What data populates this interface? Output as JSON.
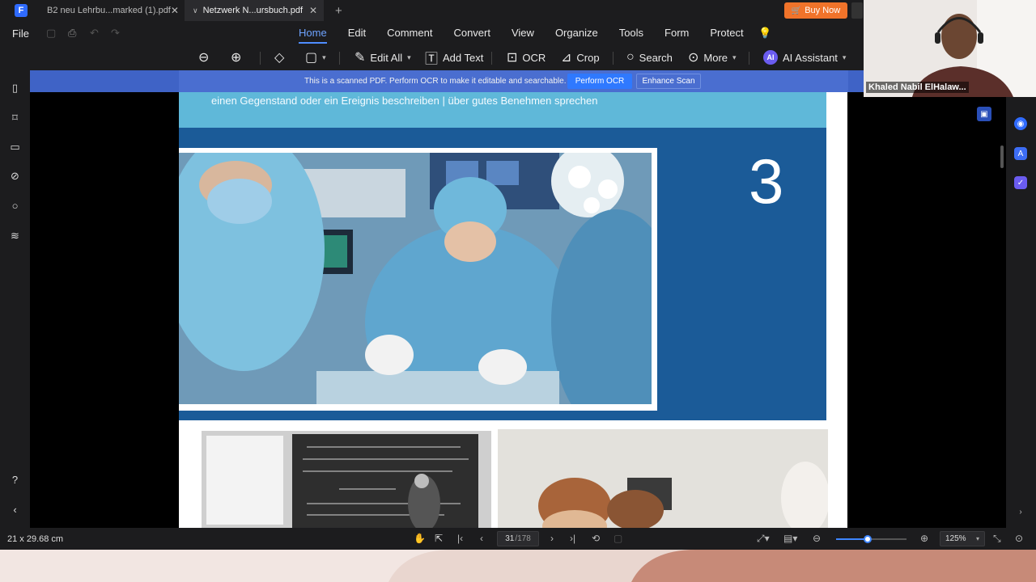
{
  "tabs": [
    {
      "label": "B2 neu Lehrbu...marked (1).pdf",
      "active": false
    },
    {
      "label": "Netzwerk N...ursbuch.pdf",
      "active": true
    }
  ],
  "buy_now": "Buy Now",
  "file_menu": "File",
  "menus": [
    "Home",
    "Edit",
    "Comment",
    "Convert",
    "View",
    "Organize",
    "Tools",
    "Form",
    "Protect"
  ],
  "toolbar": {
    "edit_all": "Edit All",
    "add_text": "Add Text",
    "ocr": "OCR",
    "crop": "Crop",
    "search": "Search",
    "more": "More",
    "ai_badge": "AI",
    "ai_assistant": "AI Assistant"
  },
  "ocr_banner": {
    "message": "This is a scanned PDF. Perform OCR to make it editable and searchable.",
    "perform_ocr": "Perform OCR",
    "enhance_scan": "Enhance Scan"
  },
  "document": {
    "subtitle": "einen Gegenstand oder ein Ereignis beschreiben  |  über gutes Benehmen sprechen",
    "chapter_number": "3"
  },
  "video": {
    "participant_name": "Khaled Nabil ElHalaw..."
  },
  "status": {
    "page_size": "21 x 29.68 cm",
    "current_page": "31",
    "total_pages": "/178",
    "zoom": "125%",
    "zoom_level": 0.45
  },
  "colors": {
    "accent": "#4f8dff",
    "buy_now": "#f0732a",
    "ocr_banner": "#3f63c6",
    "page_blue": "#1b5b98"
  }
}
